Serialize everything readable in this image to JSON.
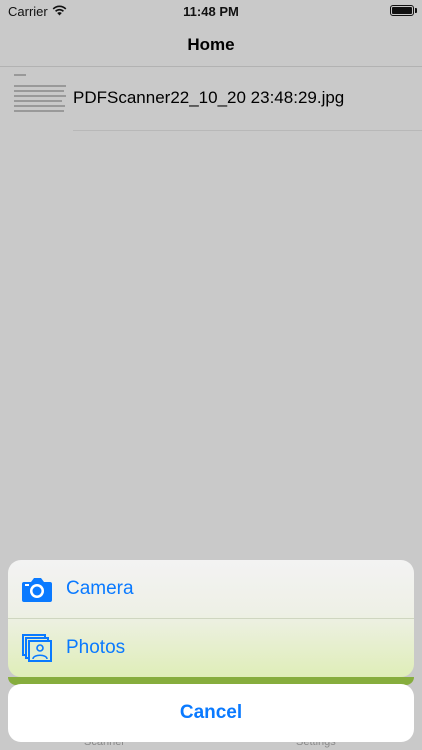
{
  "status_bar": {
    "carrier": "Carrier",
    "time": "11:48 PM"
  },
  "nav": {
    "title": "Home"
  },
  "files": [
    {
      "name": "PDFScanner22_10_20 23:48:29.jpg"
    }
  ],
  "tabs": [
    {
      "label": "Scanner"
    },
    {
      "label": "Settings"
    }
  ],
  "action_sheet": {
    "camera_label": "Camera",
    "camera_icon": "camera-icon",
    "photos_label": "Photos",
    "photos_icon": "photos-icon",
    "cancel_label": "Cancel"
  },
  "colors": {
    "accent": "#0a7aff",
    "dim_background": "#c9c9c9",
    "green_bar": "#86ad3d"
  }
}
